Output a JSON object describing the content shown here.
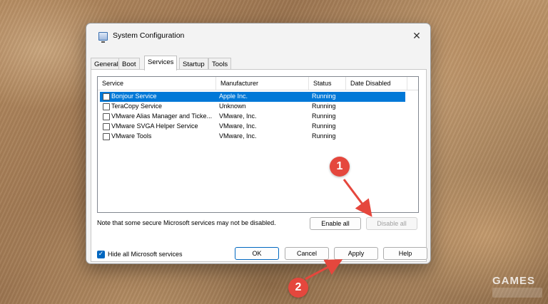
{
  "dialog": {
    "title": "System Configuration",
    "close_glyph": "✕",
    "tabs": [
      {
        "label": "General"
      },
      {
        "label": "Boot"
      },
      {
        "label": "Services",
        "active": true
      },
      {
        "label": "Startup"
      },
      {
        "label": "Tools"
      }
    ],
    "columns": [
      "Service",
      "Manufacturer",
      "Status",
      "Date Disabled"
    ],
    "services": [
      {
        "name": "Bonjour Service",
        "manufacturer": "Apple Inc.",
        "status": "Running",
        "date_disabled": "",
        "checked": false,
        "selected": true
      },
      {
        "name": "TeraCopy Service",
        "manufacturer": "Unknown",
        "status": "Running",
        "date_disabled": "",
        "checked": false,
        "selected": false
      },
      {
        "name": "VMware Alias Manager and Ticke...",
        "manufacturer": "VMware, Inc.",
        "status": "Running",
        "date_disabled": "",
        "checked": false,
        "selected": false
      },
      {
        "name": "VMware SVGA Helper Service",
        "manufacturer": "VMware, Inc.",
        "status": "Running",
        "date_disabled": "",
        "checked": false,
        "selected": false
      },
      {
        "name": "VMware Tools",
        "manufacturer": "VMware, Inc.",
        "status": "Running",
        "date_disabled": "",
        "checked": false,
        "selected": false
      }
    ],
    "note": "Note that some secure Microsoft services may not be disabled.",
    "enable_all_label": "Enable all",
    "disable_all_label": "Disable all",
    "hide_ms_label": "Hide all Microsoft services",
    "hide_ms_checked": true,
    "ok_label": "OK",
    "cancel_label": "Cancel",
    "apply_label": "Apply",
    "help_label": "Help"
  },
  "annotations": [
    {
      "number": "1"
    },
    {
      "number": "2"
    }
  ],
  "watermark": {
    "text": "GAMES"
  },
  "colors": {
    "accent": "#0078d7",
    "marker": "#e5473d"
  },
  "icons": {
    "app": "system-configuration-icon",
    "close": "close-icon",
    "checkbox": "checkbox-icon"
  }
}
